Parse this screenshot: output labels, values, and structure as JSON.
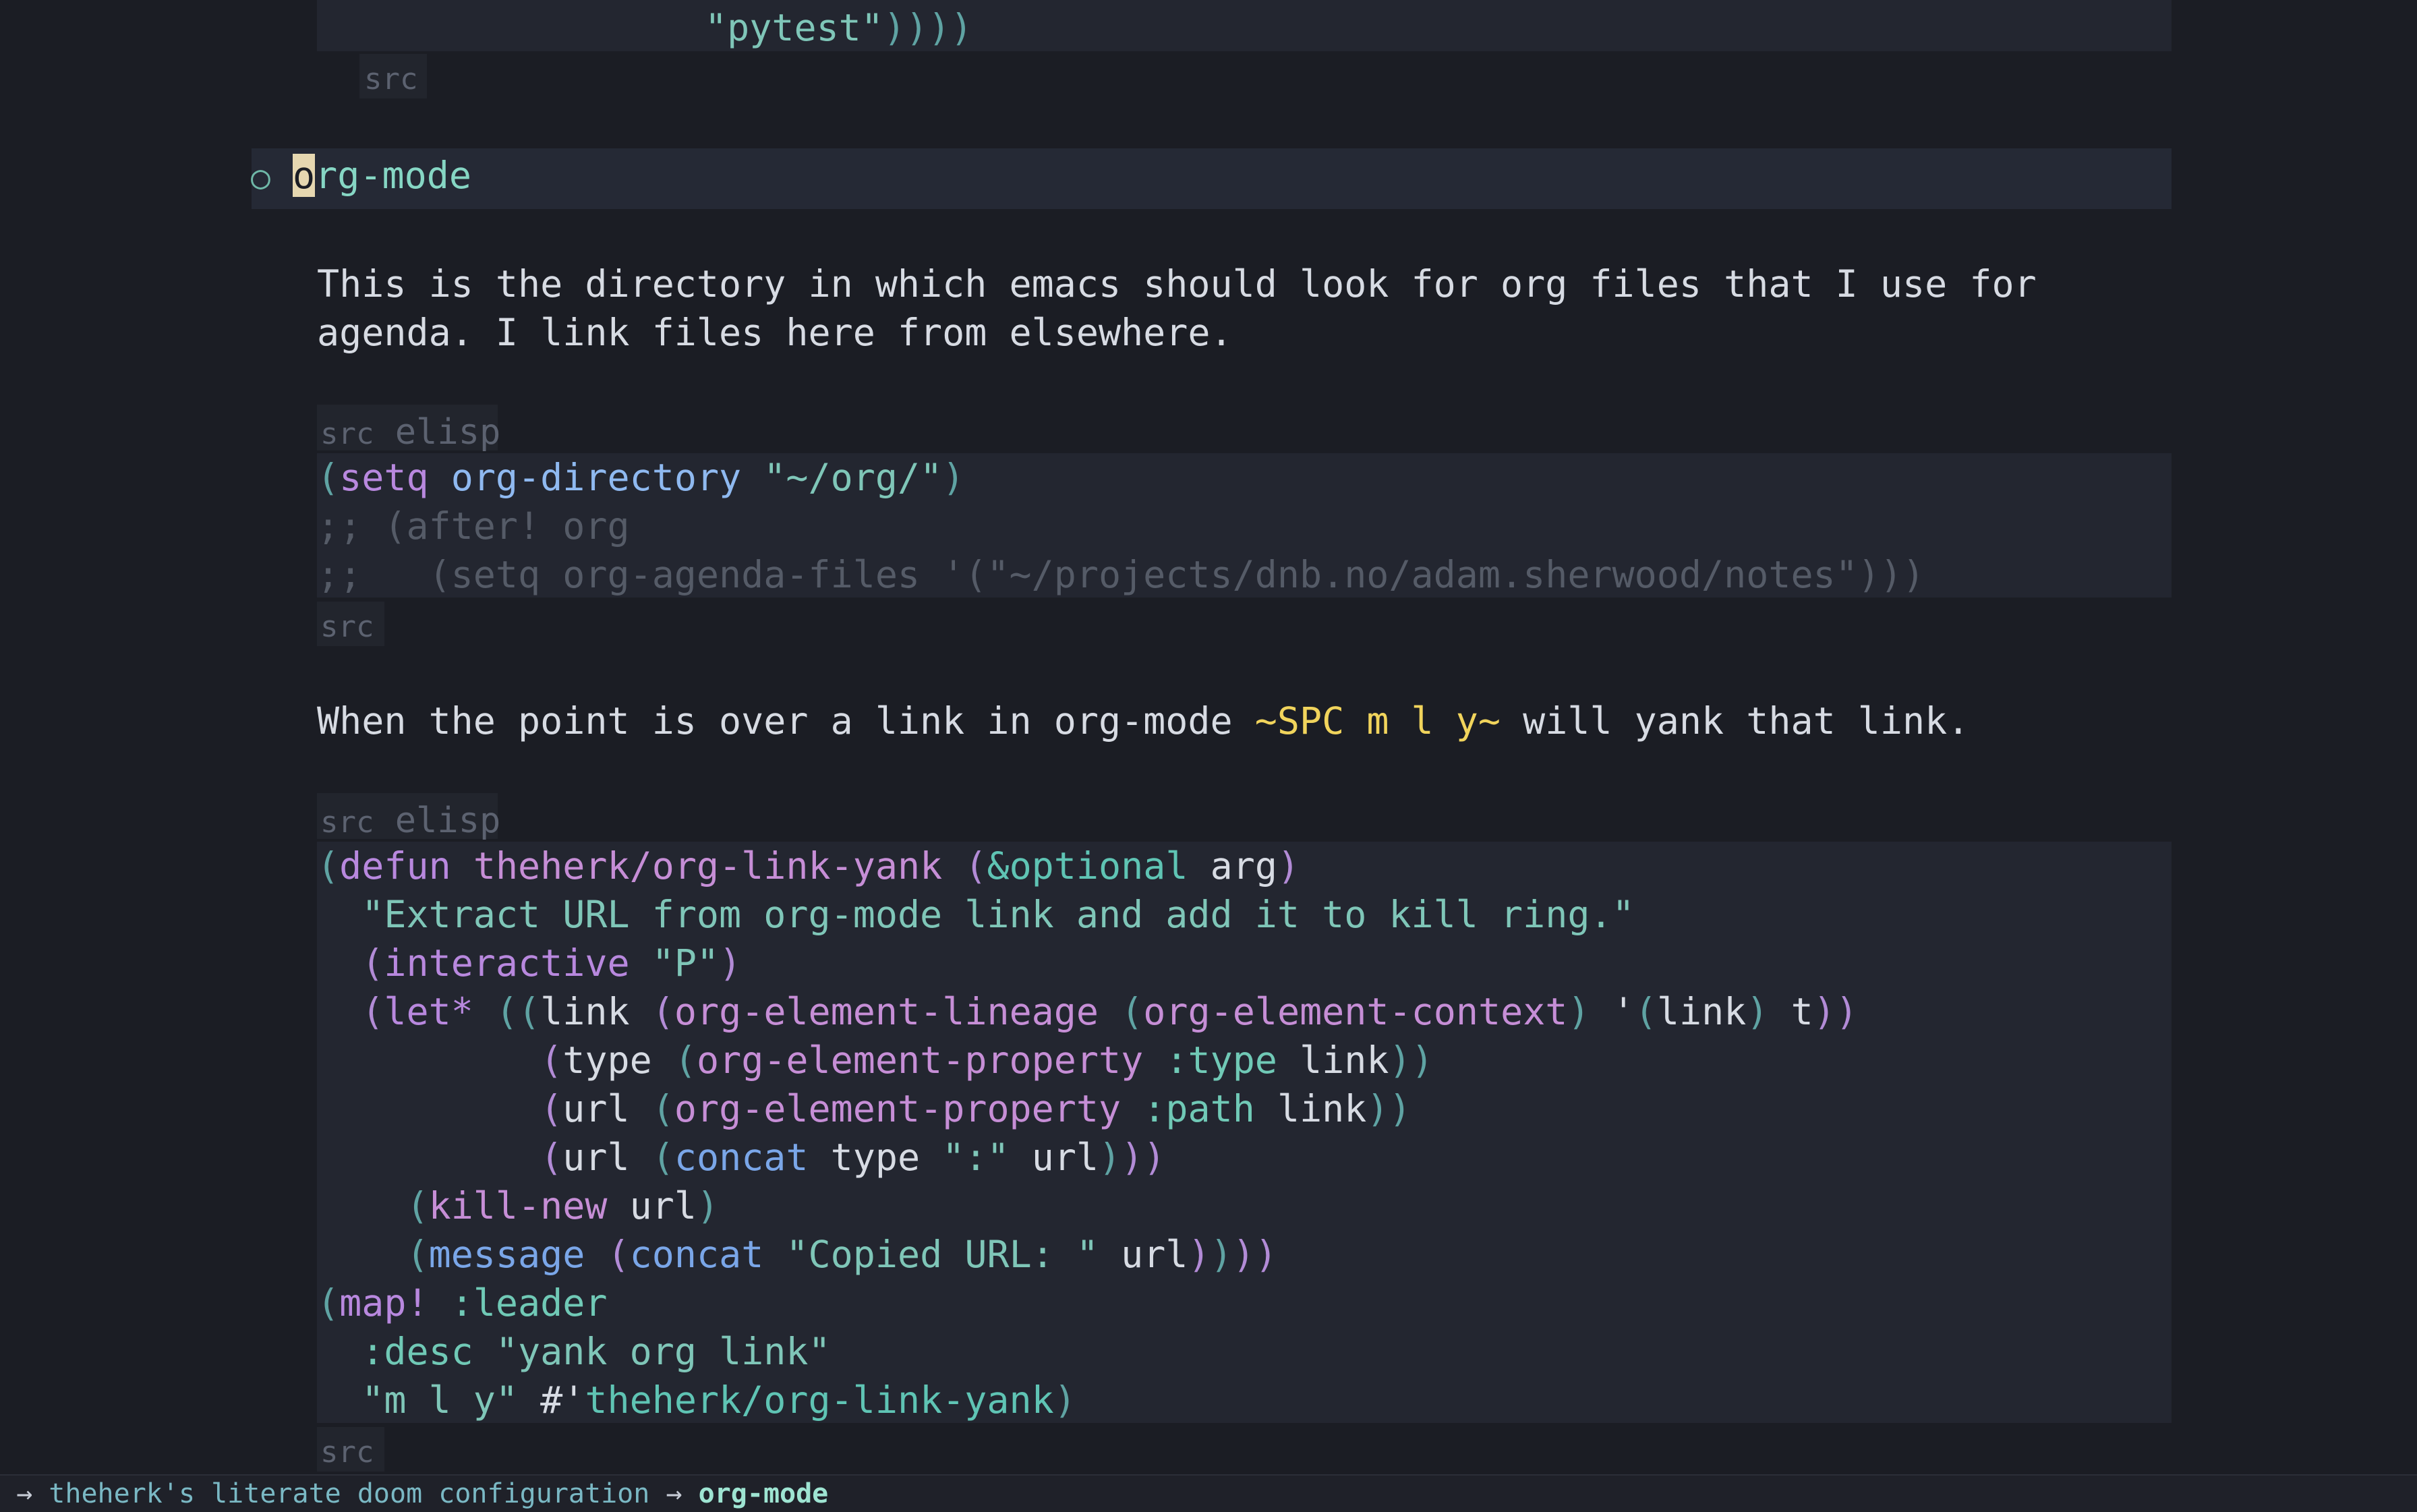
{
  "top_code": {
    "string": "\"pytest\"",
    "closers": "))))",
    "end_tag": "src"
  },
  "heading": {
    "bullet": "○",
    "cursor_char": "o",
    "rest": "rg-mode"
  },
  "paragraph1": {
    "line1": "This is the directory in which emacs should look for org files that I use for",
    "line2": "agenda. I link files here from elsewhere."
  },
  "block1": {
    "header_tag": "src",
    "header_lang": "elisp",
    "end_tag": "src",
    "l1": {
      "open": "(",
      "kw": "setq",
      "var": "org-directory",
      "str": "\"~/org/\"",
      "close": ")"
    },
    "l2": ";; (after! org",
    "l3": ";;   (setq org-agenda-files '(\"~/projects/dnb.no/adam.sherwood/notes\")))"
  },
  "paragraph2": {
    "before": "When the point is over a link in org-mode ",
    "key": "~SPC m l y~",
    "after": " will yank that link."
  },
  "block2": {
    "header_tag": "src",
    "header_lang": "elisp",
    "end_tag": "src",
    "defun": "defun",
    "fname": "theherk/org-link-yank",
    "optional": "&optional",
    "arg": "arg",
    "docstring": "\"Extract URL from org-mode link and add it to kill ring.\"",
    "interactive": "interactive",
    "interactive_arg": "\"P\"",
    "let": "let*",
    "link": "link",
    "lineage": "org-element-lineage",
    "context": "org-element-context",
    "quote_link": "link",
    "t": "t",
    "type": "type",
    "property": "org-element-property",
    "ktype": ":type",
    "url": "url",
    "kpath": ":path",
    "concat": "concat",
    "colon_str": "\":\"",
    "kill_new": "kill-new",
    "message": "message",
    "copied_str": "\"Copied URL: \"",
    "map": "map!",
    "leader": ":leader",
    "desc": ":desc",
    "desc_str": "\"yank org link\"",
    "keys_str": "\"m l y\"",
    "sharp_quote": "#'",
    "fref": "theherk/org-link-yank"
  },
  "modeline": {
    "arrow1": "→",
    "file": "theherk's literate doom configuration",
    "arrow2": "→",
    "section": "org-mode"
  }
}
